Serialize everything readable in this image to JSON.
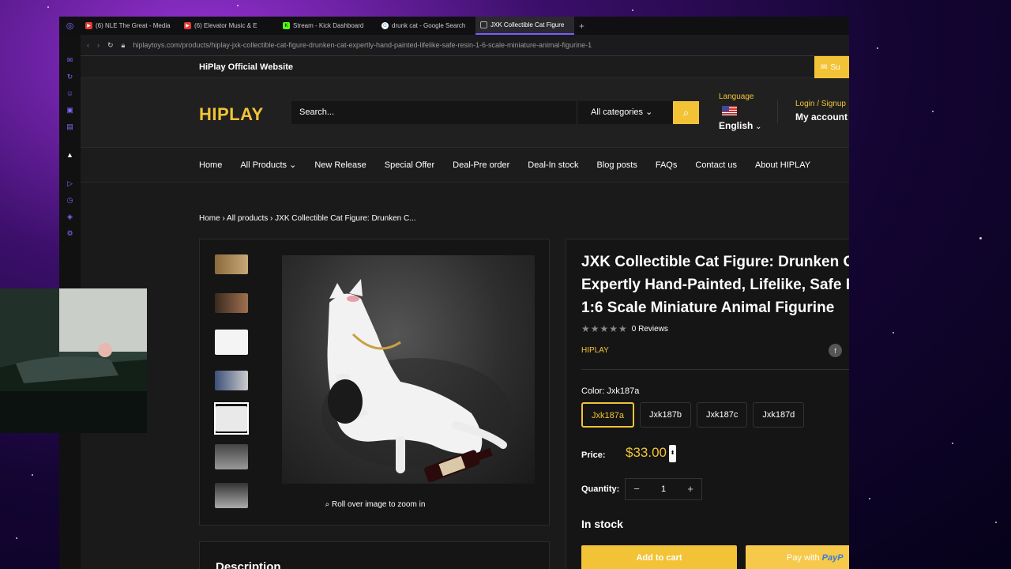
{
  "browser": {
    "tabs": [
      {
        "title": "(6) NLE The Great - Media",
        "color": "#e53935",
        "active": false
      },
      {
        "title": "(6) Elevator Music & E",
        "color": "#e53935",
        "active": false
      },
      {
        "title": "Stream - Kick Dashboard",
        "color": "#53fc18",
        "active": false
      },
      {
        "title": "drunk cat - Google Search",
        "color": "#ffffff",
        "active": false
      },
      {
        "title": "JXK Collectible Cat Figure",
        "color": "#7a5cff",
        "active": true
      }
    ],
    "url": "hiplaytoys.com/products/hiplay-jxk-collectible-cat-figure-drunken-cat-expertly-hand-painted-lifelike-safe-resin-1-6-scale-miniature-animal-figurine-1"
  },
  "site": {
    "topbar_text": "HiPlay Official Website",
    "subscribe_label": "Su",
    "logo": "HIPLAY",
    "search_placeholder": "Search...",
    "categories_label": "All categories",
    "language_label": "Language",
    "language_value": "English",
    "login_label": "Login / Signup",
    "account_label": "My account",
    "nav": [
      "Home",
      "All Products",
      "New Release",
      "Special Offer",
      "Deal-Pre order",
      "Deal-In stock",
      "Blog posts",
      "FAQs",
      "Contact us",
      "About HIPLAY"
    ]
  },
  "breadcrumb": {
    "home": "Home",
    "all": "All products",
    "current": "JXK Collectible Cat Figure: Drunken C..."
  },
  "gallery": {
    "zoom_hint": "Roll over image to zoom in",
    "active_thumb": 4
  },
  "product": {
    "title_line1": "JXK Collectible Cat Figure: Drunken Ca",
    "title_line2": "Expertly Hand-Painted, Lifelike, Safe R",
    "title_line3": "1:6 Scale Miniature Animal Figurine",
    "reviews": "0 Reviews",
    "rating_stars": 5,
    "vendor": "HIPLAY",
    "color_label": "Color: Jxk187a",
    "variants": [
      "Jxk187a",
      "Jxk187b",
      "Jxk187c",
      "Jxk187d"
    ],
    "selected_variant": "Jxk187a",
    "price_label": "Price:",
    "price": "$33.00",
    "quantity_label": "Quantity:",
    "quantity": "1",
    "stock": "In stock",
    "add_to_cart": "Add to cart",
    "paypal_prefix": "Pay with",
    "paypal_brand": "PayP"
  },
  "description_heading": "Description",
  "colors": {
    "accent": "#f2c336",
    "page_bg": "#1a1a1a",
    "browser_accent": "#7a5cff"
  }
}
